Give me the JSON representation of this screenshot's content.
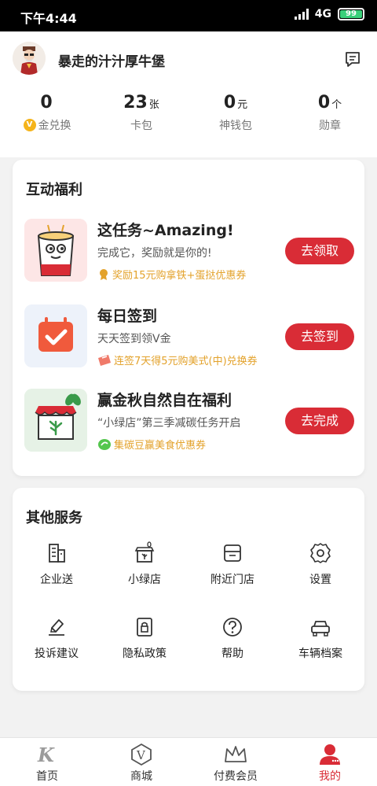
{
  "status_bar": {
    "time": "下午4:44",
    "network": "4G",
    "battery": "99"
  },
  "profile": {
    "username": "暴走的汁汁厚牛堡"
  },
  "stats": [
    {
      "value": "0",
      "unit": "",
      "label": "金兑换",
      "icon": "v-coin-icon"
    },
    {
      "value": "23",
      "unit": "张",
      "label": "卡包"
    },
    {
      "value": "0",
      "unit": "元",
      "label": "神钱包"
    },
    {
      "value": "0",
      "unit": "个",
      "label": "勋章"
    }
  ],
  "welfare": {
    "title": "互动福利",
    "tasks": [
      {
        "title": "这任务~Amazing!",
        "desc": "完成它，奖励就是你的!",
        "reward": "奖励15元购拿铁+蛋挞优惠券",
        "button": "去领取",
        "icon": "cup-mascot-icon"
      },
      {
        "title": "每日签到",
        "desc": "天天签到领V金",
        "reward": "连签7天得5元购美式(中)兑换券",
        "button": "去签到",
        "icon": "calendar-check-icon"
      },
      {
        "title": "赢金秋自然自在福利",
        "desc": "“小绿店”第三季减碳任务开启",
        "reward": "集碳豆赢美食优惠券",
        "button": "去完成",
        "icon": "green-store-icon"
      }
    ]
  },
  "services": {
    "title": "其他服务",
    "items": [
      {
        "label": "企业送",
        "icon": "building-icon"
      },
      {
        "label": "小绿店",
        "icon": "green-store-icon"
      },
      {
        "label": "附近门店",
        "icon": "store-box-icon"
      },
      {
        "label": "设置",
        "icon": "gear-icon"
      },
      {
        "label": "投诉建议",
        "icon": "feedback-icon"
      },
      {
        "label": "隐私政策",
        "icon": "privacy-lock-icon"
      },
      {
        "label": "帮助",
        "icon": "help-icon"
      },
      {
        "label": "车辆档案",
        "icon": "car-icon"
      }
    ]
  },
  "tabbar": [
    {
      "label": "首页",
      "icon": "home-k-icon"
    },
    {
      "label": "商城",
      "icon": "mall-v-icon"
    },
    {
      "label": "付费会员",
      "icon": "crown-icon"
    },
    {
      "label": "我的",
      "icon": "profile-icon",
      "active": true
    }
  ],
  "colors": {
    "accent": "#d92c36",
    "reward": "#e3a22b",
    "background": "#f2f2f2"
  }
}
